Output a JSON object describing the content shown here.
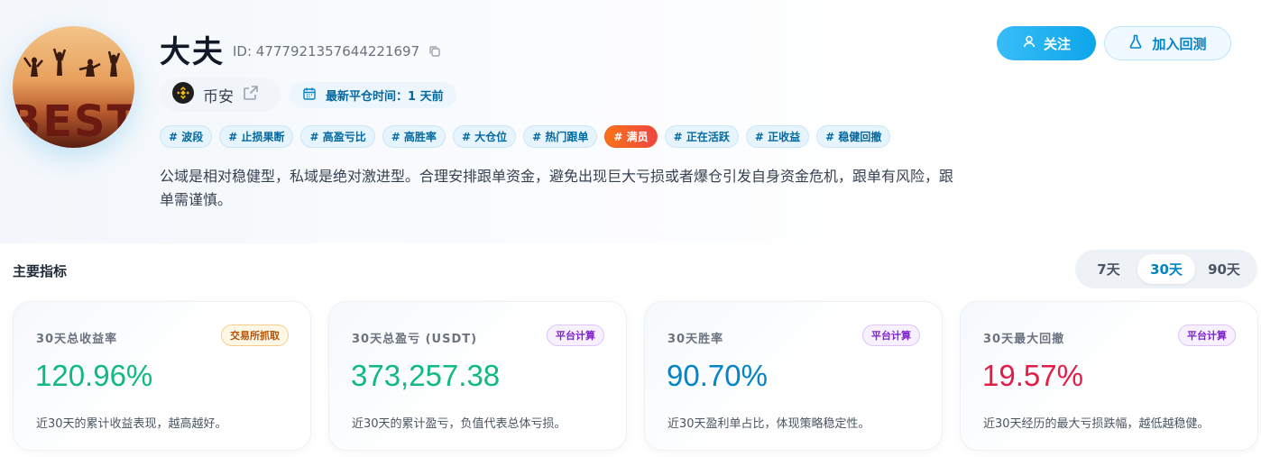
{
  "profile": {
    "name": "大夫",
    "id_text": "ID: 4777921357644221697",
    "avatar_text": "BEST",
    "exchange": "币安",
    "latest_label": "最新平仓时间：1 天前",
    "description": "公域是相对稳健型，私域是绝对激进型。合理安排跟单资金，避免出现巨大亏损或者爆仓引发自身资金危机，跟单有风险，跟单需谨慎。"
  },
  "actions": {
    "follow_label": "关注",
    "backtest_label": "加入回测"
  },
  "tags": [
    {
      "label": "# 波段",
      "hot": false
    },
    {
      "label": "# 止损果断",
      "hot": false
    },
    {
      "label": "# 高盈亏比",
      "hot": false
    },
    {
      "label": "# 高胜率",
      "hot": false
    },
    {
      "label": "# 大仓位",
      "hot": false
    },
    {
      "label": "# 热门跟单",
      "hot": false
    },
    {
      "label": "# 满员",
      "hot": true
    },
    {
      "label": "# 正在活跃",
      "hot": false
    },
    {
      "label": "# 正收益",
      "hot": false
    },
    {
      "label": "# 稳健回撤",
      "hot": false
    }
  ],
  "metrics_section": {
    "title": "主要指标",
    "ranges": [
      "7天",
      "30天",
      "90天"
    ],
    "active_range": "30天"
  },
  "metrics": [
    {
      "label": "30天总收益率",
      "badge": "交易所抓取",
      "badge_style": "orange",
      "value": "120.96%",
      "value_color": "#10b981",
      "note": "近30天的累计收益表现，越高越好。"
    },
    {
      "label": "30天总盈亏 (USDT)",
      "badge": "平台计算",
      "badge_style": "purple",
      "value": "373,257.38",
      "value_color": "#10b981",
      "note": "近30天的累计盈亏，负值代表总体亏损。"
    },
    {
      "label": "30天胜率",
      "badge": "平台计算",
      "badge_style": "purple",
      "value": "90.70%",
      "value_color": "#0284c7",
      "note": "近30天盈利单占比，体现策略稳定性。"
    },
    {
      "label": "30天最大回撤",
      "badge": "平台计算",
      "badge_style": "purple",
      "value": "19.57%",
      "value_color": "#e11d48",
      "note": "近30天经历的最大亏损跌幅，越低越稳健。"
    }
  ],
  "colors": {
    "accent": "#0ea5e9",
    "positive": "#10b981",
    "negative": "#e11d48",
    "hot_tag": "#ef4444"
  },
  "icons": {
    "copy": "copy-icon",
    "user": "user-icon",
    "flask": "flask-icon",
    "exchange_logo": "binance-logo-icon",
    "external": "external-link-icon",
    "calendar": "calendar-icon"
  }
}
